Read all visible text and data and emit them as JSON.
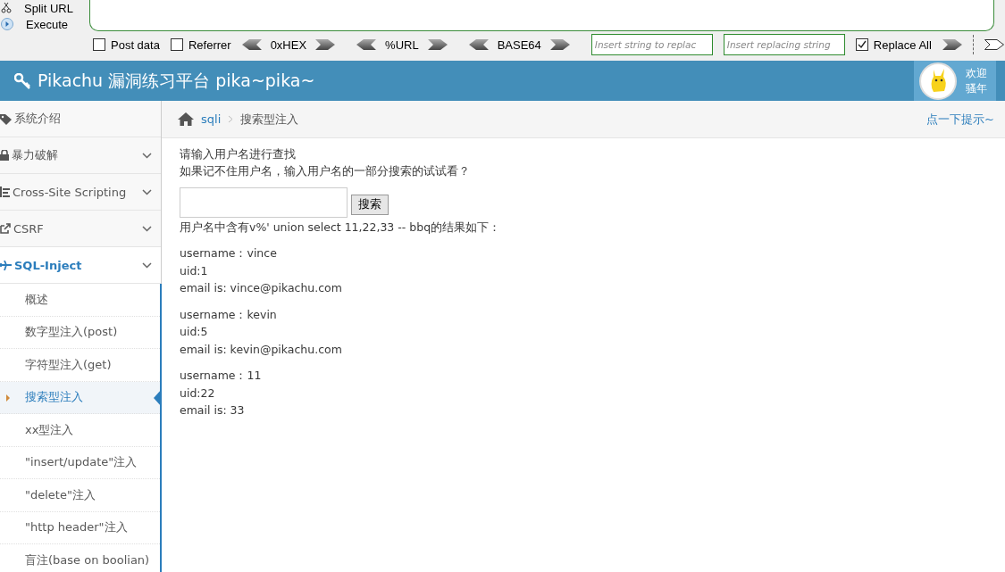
{
  "toolbar": {
    "side_actions": [
      {
        "label": "Split URL",
        "kind": "split"
      },
      {
        "label": "Execute",
        "kind": "execute"
      }
    ],
    "options": [
      {
        "kind": "checkbox",
        "label": "Post data",
        "checked": false
      },
      {
        "kind": "checkbox",
        "label": "Referrer",
        "checked": false
      },
      {
        "kind": "encode",
        "label": "0xHEX"
      },
      {
        "kind": "encode",
        "label": "%URL"
      },
      {
        "kind": "encode",
        "label": "BASE64"
      },
      {
        "kind": "field",
        "placeholder": "Insert string to replac"
      },
      {
        "kind": "field",
        "placeholder": "Insert replacing string"
      },
      {
        "kind": "checkbox",
        "label": "Replace All",
        "checked": true
      }
    ]
  },
  "navbar": {
    "title": "Pikachu 漏洞练习平台 pika~pika~",
    "welcome": "欢迎",
    "user": "骚年"
  },
  "sidebar": {
    "items": [
      {
        "label": "系统介绍",
        "expanded": false
      },
      {
        "label": "暴力破解",
        "expanded": false
      },
      {
        "label": "Cross-Site Scripting",
        "expanded": false
      },
      {
        "label": "CSRF",
        "expanded": false
      },
      {
        "label": "SQL-Inject",
        "expanded": true,
        "children": [
          {
            "label": "概述",
            "selected": false
          },
          {
            "label": "数字型注入(post)",
            "selected": false
          },
          {
            "label": "字符型注入(get)",
            "selected": false
          },
          {
            "label": "搜索型注入",
            "selected": true
          },
          {
            "label": "xx型注入",
            "selected": false
          },
          {
            "label": "\"insert/update\"注入",
            "selected": false
          },
          {
            "label": "\"delete\"注入",
            "selected": false
          },
          {
            "label": "\"http header\"注入",
            "selected": false
          },
          {
            "label": "盲注(base on boolian)",
            "selected": false
          }
        ]
      }
    ]
  },
  "breadcrumb": {
    "items": [
      "sqli",
      "搜索型注入"
    ],
    "hint": "点一下提示~"
  },
  "content": {
    "intro": [
      "请输入用户名进行查找",
      "如果记不住用户名，输入用户名的一部分搜索的试试看？"
    ],
    "search_button": "搜索",
    "result_title": "用户名中含有v%' union select 11,22,33 -- bbq的结果如下：",
    "results": [
      [
        "username：vince",
        "uid:1",
        "email is: vince@pikachu.com"
      ],
      [
        "username：kevin",
        "uid:5",
        "email is: kevin@pikachu.com"
      ],
      [
        "username：11",
        "uid:22",
        "email is: 33"
      ]
    ]
  }
}
